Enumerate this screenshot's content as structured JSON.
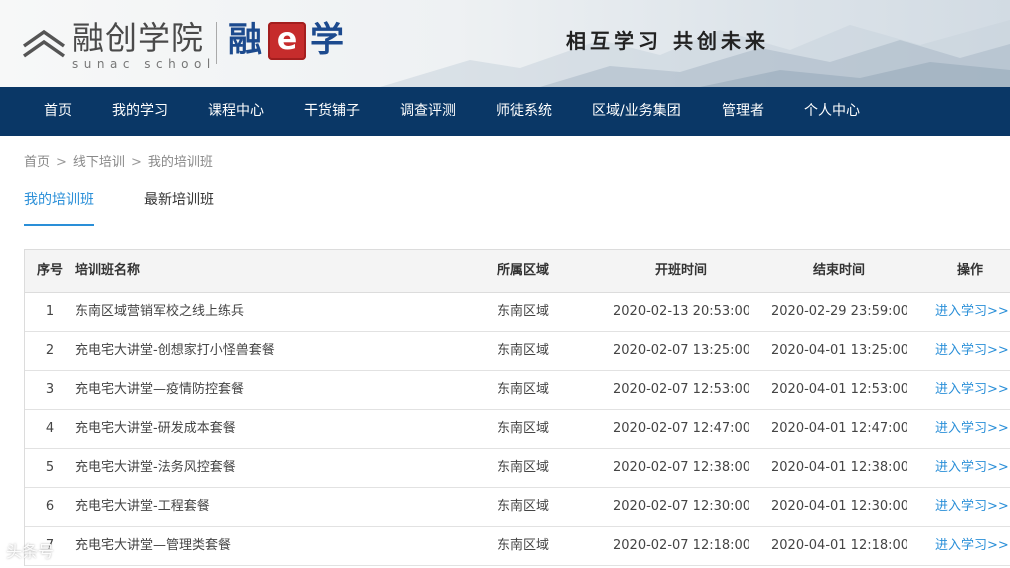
{
  "header": {
    "logo_cn": "融创学院",
    "logo_en": "sunac school",
    "brand_left": "融",
    "brand_e": "e",
    "brand_right": "学",
    "slogan": "相互学习 共创未来"
  },
  "nav": {
    "items": [
      "首页",
      "我的学习",
      "课程中心",
      "干货铺子",
      "调查评测",
      "师徒系统",
      "区域/业务集团",
      "管理者",
      "个人中心"
    ]
  },
  "breadcrumb": {
    "items": [
      "首页",
      "线下培训",
      "我的培训班"
    ],
    "separator": ">"
  },
  "tabs": {
    "active": "我的培训班",
    "other": "最新培训班"
  },
  "table": {
    "headers": {
      "no": "序号",
      "name": "培训班名称",
      "region": "所属区域",
      "start": "开班时间",
      "end": "结束时间",
      "op": "操作"
    },
    "rows": [
      {
        "no": "1",
        "name": "东南区域营销军校之线上练兵",
        "region": "东南区域",
        "start": "2020-02-13 20:53:00",
        "end": "2020-02-29 23:59:00",
        "op": "进入学习>>"
      },
      {
        "no": "2",
        "name": "充电宅大讲堂-创想家打小怪兽套餐",
        "region": "东南区域",
        "start": "2020-02-07 13:25:00",
        "end": "2020-04-01 13:25:00",
        "op": "进入学习>>"
      },
      {
        "no": "3",
        "name": "充电宅大讲堂—疫情防控套餐",
        "region": "东南区域",
        "start": "2020-02-07 12:53:00",
        "end": "2020-04-01 12:53:00",
        "op": "进入学习>>"
      },
      {
        "no": "4",
        "name": "充电宅大讲堂-研发成本套餐",
        "region": "东南区域",
        "start": "2020-02-07 12:47:00",
        "end": "2020-04-01 12:47:00",
        "op": "进入学习>>"
      },
      {
        "no": "5",
        "name": "充电宅大讲堂-法务风控套餐",
        "region": "东南区域",
        "start": "2020-02-07 12:38:00",
        "end": "2020-04-01 12:38:00",
        "op": "进入学习>>"
      },
      {
        "no": "6",
        "name": "充电宅大讲堂-工程套餐",
        "region": "东南区域",
        "start": "2020-02-07 12:30:00",
        "end": "2020-04-01 12:30:00",
        "op": "进入学习>>"
      },
      {
        "no": "7",
        "name": "充电宅大讲堂—管理类套餐",
        "region": "东南区域",
        "start": "2020-02-07 12:18:00",
        "end": "2020-04-01 12:18:00",
        "op": "进入学习>>"
      }
    ]
  },
  "watermark": "头条号",
  "colors": {
    "nav_bg": "#0a3766",
    "accent": "#2a8fd8",
    "brand_blue": "#1c4a8e",
    "brand_red": "#c62c2c"
  }
}
